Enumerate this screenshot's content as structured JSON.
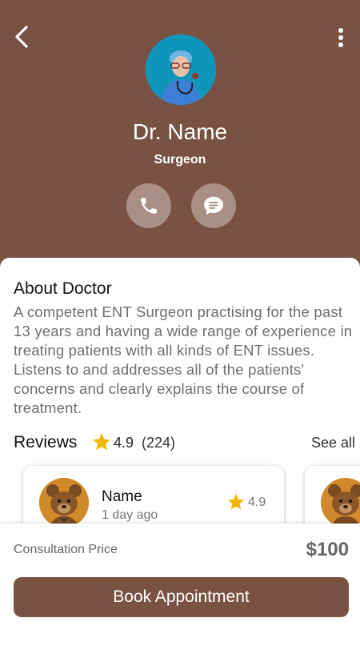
{
  "colors": {
    "header_bg": "#7a5244",
    "button_bg": "#7a5244",
    "round_button_bg": "#a98f86",
    "star": "#f5b400"
  },
  "header": {
    "back_icon": "chevron-left-icon",
    "menu_icon": "more-vertical-icon"
  },
  "doctor": {
    "name": "Dr. Name",
    "role": "Surgeon",
    "avatar": "doctor-photo"
  },
  "actions": {
    "call_icon": "phone-icon",
    "chat_icon": "chat-bubble-icon"
  },
  "about": {
    "title": "About Doctor",
    "text": "A competent ENT Surgeon practising for the past 13 years and having a wide range of experience in treating patients with all kinds of ENT issues. Listens to and addresses all of the patients' concerns and clearly explains the course of treatment."
  },
  "reviews": {
    "title": "Reviews",
    "rating": "4.9",
    "count": "(224)",
    "see_all": "See all",
    "items": [
      {
        "name": "Name",
        "time": "1 day ago",
        "rating": "4.9",
        "avatar": "teddy-bear-avatar"
      },
      {
        "name": "",
        "time": "",
        "rating": "",
        "avatar": "teddy-bear-avatar"
      }
    ]
  },
  "booking": {
    "price_label": "Consultation Price",
    "price": "$100",
    "button_label": "Book Appointment"
  }
}
